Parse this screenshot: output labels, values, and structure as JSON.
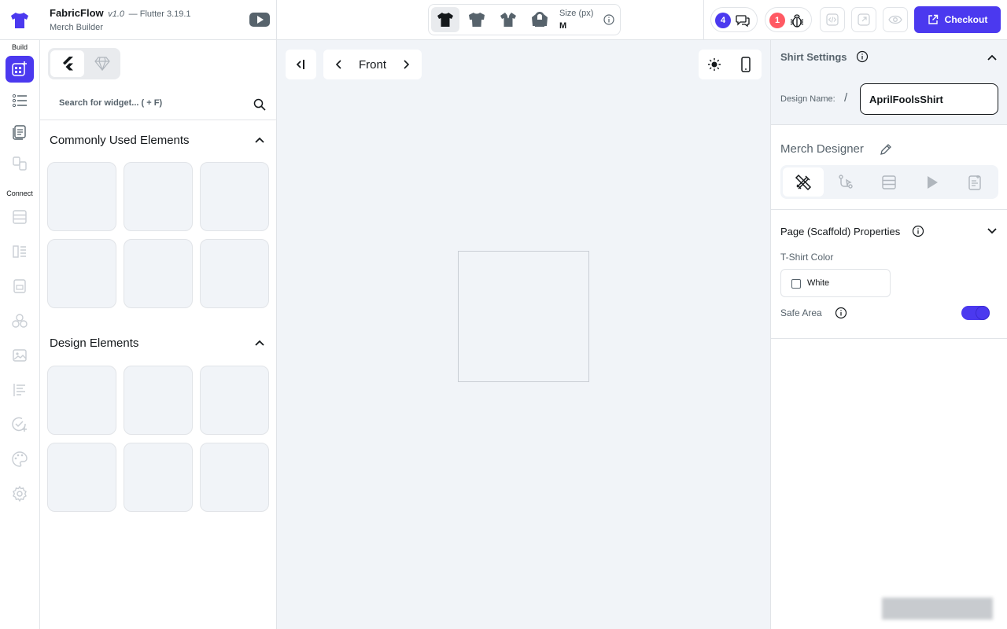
{
  "header": {
    "app_name": "FabricFlow",
    "version": "v1.0",
    "flutter_version": "— Flutter 3.19.1",
    "subtitle": "Merch Builder",
    "size_label": "Size (px)",
    "size_value": "M",
    "comments_count": "4",
    "bugs_count": "1",
    "checkout_label": "Checkout"
  },
  "rail": {
    "build_label": "Build",
    "connect_label": "Connect"
  },
  "widget_panel": {
    "search_placeholder": "Search for widget... ( + F)",
    "sections": [
      {
        "title": "Commonly Used Elements"
      },
      {
        "title": "Design Elements"
      }
    ]
  },
  "canvas": {
    "page_label": "Front"
  },
  "properties": {
    "panel_title": "Shirt Settings",
    "design_name_label": "Design Name:",
    "design_name_value": "AprilFoolsShirt",
    "merch_designer_title": "Merch Designer",
    "page_props_title": "Page (Scaffold) Properties",
    "tshirt_color_label": "T-Shirt Color",
    "tshirt_color_value": "White",
    "safe_area_label": "Safe Area",
    "safe_area_on": true
  },
  "colors": {
    "accent": "#4b39ef",
    "bug_badge": "#ff5963",
    "canvas_bg": "#f1f4f8",
    "text_primary": "#14181b",
    "text_secondary": "#57636c"
  }
}
